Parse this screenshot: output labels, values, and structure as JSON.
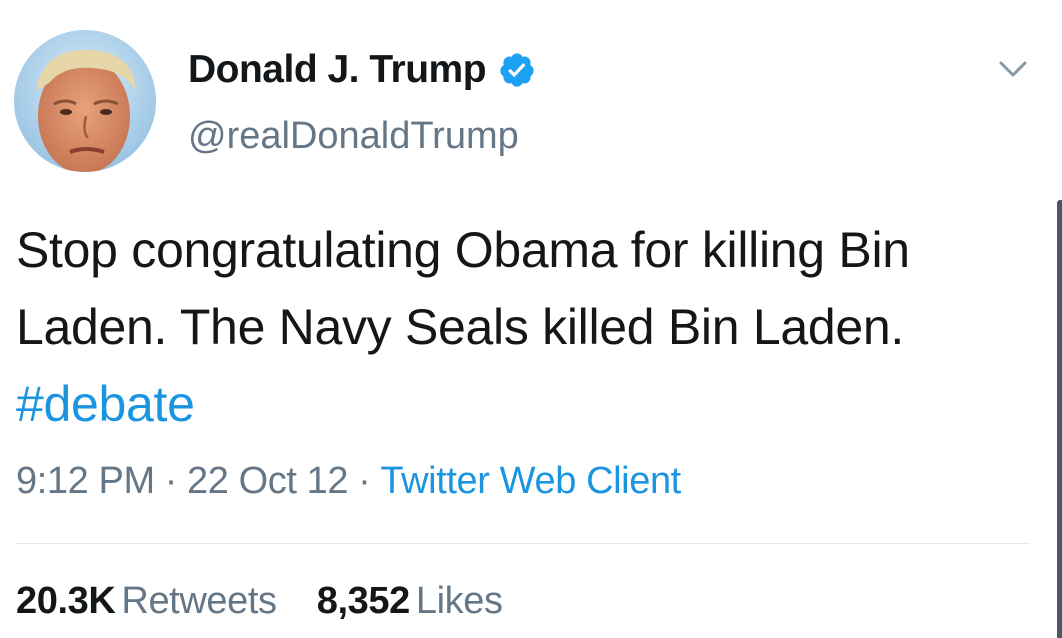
{
  "author": {
    "display_name": "Donald J. Trump",
    "handle": "@realDonaldTrump",
    "verified": true
  },
  "tweet": {
    "text_plain": "Stop congratulating Obama for killing Bin Laden. The Navy Seals killed Bin Laden.",
    "hashtag": "#debate"
  },
  "meta": {
    "time": "9:12 PM",
    "date": "22 Oct 12",
    "separator": "·",
    "source": "Twitter Web Client"
  },
  "stats": {
    "retweets_count": "20.3K",
    "retweets_label": "Retweets",
    "likes_count": "8,352",
    "likes_label": "Likes"
  },
  "colors": {
    "link": "#1b95e0",
    "secondary_text": "#657786",
    "verified_badge": "#1da1f2"
  },
  "icons": {
    "verified": "verified-badge-icon",
    "caret": "chevron-down-icon"
  }
}
